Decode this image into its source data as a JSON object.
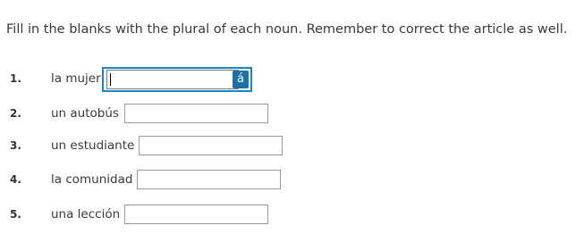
{
  "instructions": "Fill in the blanks with the plural of each noun. Remember to correct the article as well.",
  "accent_button_label": "á",
  "items": [
    {
      "number": "1.",
      "noun": "la mujer",
      "answer": ""
    },
    {
      "number": "2.",
      "noun": "un autobús",
      "answer": ""
    },
    {
      "number": "3.",
      "noun": "un estudiante",
      "answer": ""
    },
    {
      "number": "4.",
      "noun": "la comunidad",
      "answer": ""
    },
    {
      "number": "5.",
      "noun": "una lección",
      "answer": ""
    }
  ]
}
